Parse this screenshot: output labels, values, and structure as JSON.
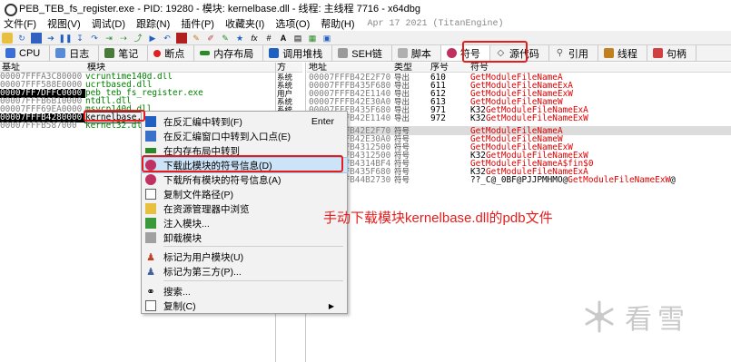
{
  "window": {
    "title": "PEB_TEB_fs_register.exe - PID: 19280 - 模块: kernelbase.dll - 线程: 主线程 7716 - x64dbg"
  },
  "menu": {
    "items": [
      "文件(F)",
      "视图(V)",
      "调试(D)",
      "跟踪(N)",
      "插件(P)",
      "收藏夹(I)",
      "选项(O)",
      "帮助(H)"
    ],
    "date": "Apr 17 2021 (TitanEngine)"
  },
  "tabs": [
    {
      "label": "CPU",
      "icon": "cpu-icon",
      "color": "#3a6fd8"
    },
    {
      "label": "日志",
      "icon": "log-icon",
      "color": "#5a8bd8"
    },
    {
      "label": "笔记",
      "icon": "notes-icon",
      "color": "#4a7a3a"
    },
    {
      "label": "断点",
      "icon": "breakpoint-icon",
      "color": "#e02020"
    },
    {
      "label": "内存布局",
      "icon": "memory-map-icon",
      "color": "#2a8a2a"
    },
    {
      "label": "调用堆栈",
      "icon": "call-stack-icon",
      "color": "#2060c0"
    },
    {
      "label": "SEH链",
      "icon": "seh-icon",
      "color": "#606060"
    },
    {
      "label": "脚本",
      "icon": "script-icon",
      "color": "#808080"
    },
    {
      "label": "符号",
      "icon": "symbols-icon",
      "color": "#c03060"
    },
    {
      "label": "源代码",
      "icon": "source-icon",
      "color": "#404040"
    },
    {
      "label": "引用",
      "icon": "references-icon",
      "color": "#606060"
    },
    {
      "label": "线程",
      "icon": "threads-icon",
      "color": "#c08020"
    },
    {
      "label": "句柄",
      "icon": "handles-icon",
      "color": "#d04040"
    }
  ],
  "modules_pane": {
    "headers": {
      "base": "基址",
      "module": "模块",
      "party": "方"
    },
    "rows": [
      {
        "base": "00007FFFA3C80000",
        "module": "vcruntime140d.dll",
        "party": "系统"
      },
      {
        "base": "00007FFF588E0000",
        "module": "ucrtbased.dll",
        "party": "系统"
      },
      {
        "base": "00007FF7DFFC0000",
        "module": "peb_teb_fs_register.exe",
        "party": "用户"
      },
      {
        "base": "00007FFFB6B10000",
        "module": "ntdll.dll",
        "party": "系统"
      },
      {
        "base": "00007FFF69EA0000",
        "module": "msvcp140d.dll",
        "party": "系统"
      },
      {
        "base": "00007FFFB4280000",
        "module": "kernelbase.dll",
        "party": "系统"
      },
      {
        "base": "00007FFFB587000",
        "module": "kernel32.dll",
        "party": "系统"
      }
    ]
  },
  "symbols_pane": {
    "headers": {
      "address": "地址",
      "type": "类型",
      "ordinal": "序号",
      "symbol": "符号"
    },
    "rows": [
      {
        "address": "00007FFFB42E2F70",
        "type": "导出",
        "ordinal": "610",
        "prefix": "",
        "hl": "GetModuleFileNameA",
        "suffix": ""
      },
      {
        "address": "00007FFFB435F680",
        "type": "导出",
        "ordinal": "611",
        "prefix": "",
        "hl": "GetModuleFileNameExA",
        "suffix": ""
      },
      {
        "address": "00007FFFB42E1140",
        "type": "导出",
        "ordinal": "612",
        "prefix": "",
        "hl": "GetModuleFileNameExW",
        "suffix": ""
      },
      {
        "address": "00007FFFB42E30A0",
        "type": "导出",
        "ordinal": "613",
        "prefix": "",
        "hl": "GetModuleFileNameW",
        "suffix": ""
      },
      {
        "address": "00007FFFB435F680",
        "type": "导出",
        "ordinal": "971",
        "prefix": "K32",
        "hl": "GetModuleFileNameExA",
        "suffix": ""
      },
      {
        "address": "00007FFFB42E1140",
        "type": "导出",
        "ordinal": "972",
        "prefix": "K32",
        "hl": "GetModuleFileNameExW",
        "suffix": ""
      },
      {
        "address": "00007FFFB42E2F70",
        "type": "符号",
        "ordinal": "",
        "prefix": "",
        "hl": "GetModuleFileNameA",
        "suffix": ""
      },
      {
        "address": "00007FFFB42E30A0",
        "type": "符号",
        "ordinal": "",
        "prefix": "",
        "hl": "GetModuleFileNameW",
        "suffix": ""
      },
      {
        "address": "00007FFFB4312500",
        "type": "符号",
        "ordinal": "",
        "prefix": "",
        "hl": "GetModuleFileNameExW",
        "suffix": ""
      },
      {
        "address": "00007FFFB4312500",
        "type": "符号",
        "ordinal": "",
        "prefix": "K32",
        "hl": "GetModuleFileNameExW",
        "suffix": ""
      },
      {
        "address": "00007FFFB4314BF4",
        "type": "符号",
        "ordinal": "",
        "prefix": "",
        "hl": "GetModuleFileNameA$fin$0",
        "suffix": ""
      },
      {
        "address": "00007FFFB435F680",
        "type": "符号",
        "ordinal": "",
        "prefix": "K32",
        "hl": "GetModuleFileNameExA",
        "suffix": ""
      },
      {
        "address": "00007FFFB44B2730",
        "type": "符号",
        "ordinal": "",
        "prefix": "??_C@_0BF@PJJPMHMO@",
        "hl": "GetModuleFileNameExW",
        "suffix": "@"
      }
    ]
  },
  "context_menu": {
    "items": [
      {
        "label": "在反汇编中转到(F)",
        "shortcut": "Enter",
        "icon": "disassembly-goto-icon"
      },
      {
        "label": "在反汇编窗口中转到入口点(E)",
        "shortcut": "",
        "icon": "entry-point-icon"
      },
      {
        "label": "在内存布局中转到",
        "shortcut": "",
        "icon": "memory-map-goto-icon"
      },
      {
        "label": "下载此模块的符号信息(D)",
        "shortcut": "",
        "icon": "download-symbols-icon"
      },
      {
        "label": "下载所有模块的符号信息(A)",
        "shortcut": "",
        "icon": "download-all-symbols-icon"
      },
      {
        "label": "复制文件路径(P)",
        "shortcut": "",
        "icon": "copy-path-icon"
      },
      {
        "label": "在资源管理器中浏览",
        "shortcut": "",
        "icon": "explorer-icon"
      },
      {
        "label": "注入模块...",
        "shortcut": "",
        "icon": "inject-module-icon"
      },
      {
        "label": "卸载模块",
        "shortcut": "",
        "icon": "unload-module-icon"
      },
      {
        "label": "标记为用户模块(U)",
        "shortcut": "",
        "icon": "user-module-icon"
      },
      {
        "label": "标记为第三方(P)...",
        "shortcut": "",
        "icon": "third-party-icon"
      },
      {
        "label": "搜索...",
        "shortcut": "",
        "icon": "search-icon"
      },
      {
        "label": "复制(C)",
        "shortcut": "",
        "icon": "copy-icon"
      }
    ]
  },
  "annotation": {
    "text": "手动下载模块kernelbase.dll的pdb文件"
  },
  "watermark": {
    "text": "看雪"
  },
  "colors": {
    "annotation_red": "#e81c1c",
    "module_green": "#008000",
    "symbol_red": "#e00000",
    "menu_highlight": "#cce4f7"
  }
}
